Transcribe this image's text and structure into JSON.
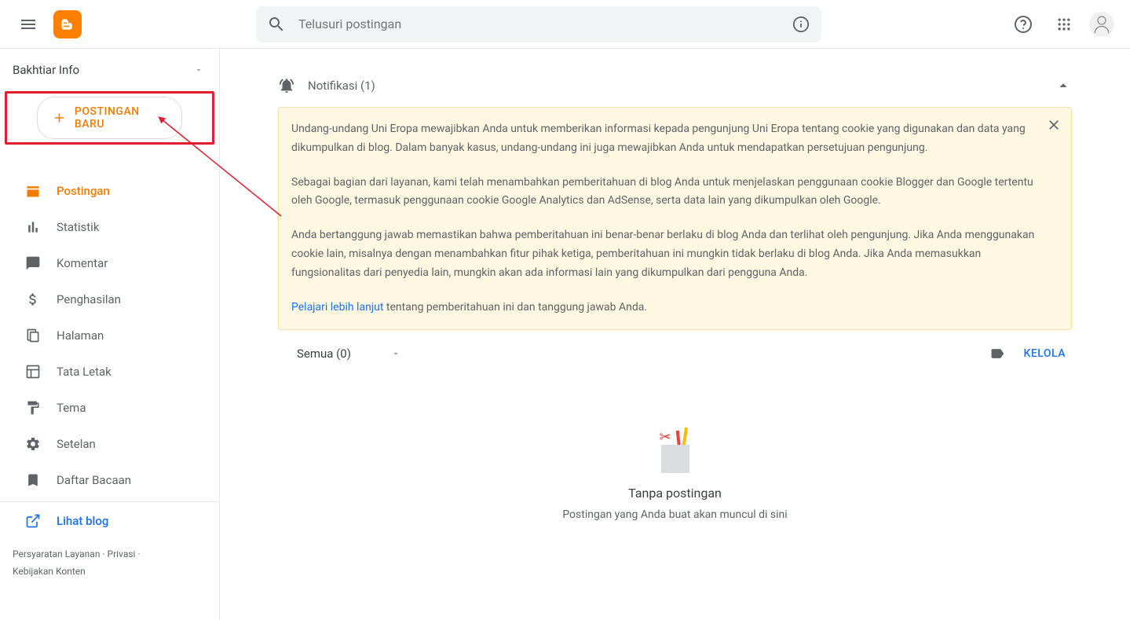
{
  "header": {
    "search_placeholder": "Telusuri postingan"
  },
  "sidebar": {
    "blog_name": "Bakhtiar Info",
    "new_post_label": "POSTINGAN BARU",
    "nav": {
      "postingan": "Postingan",
      "statistik": "Statistik",
      "komentar": "Komentar",
      "penghasilan": "Penghasilan",
      "halaman": "Halaman",
      "tata_letak": "Tata Letak",
      "tema": "Tema",
      "setelan": "Setelan",
      "daftar_bacaan": "Daftar Bacaan",
      "lihat_blog": "Lihat blog"
    },
    "footer": {
      "tos": "Persyaratan Layanan",
      "privacy": "Privasi",
      "content_policy": "Kebijakan Konten"
    }
  },
  "main": {
    "notification_title": "Notifikasi (1)",
    "warning": {
      "p1": "Undang-undang Uni Eropa mewajibkan Anda untuk memberikan informasi kepada pengunjung Uni Eropa tentang cookie yang digunakan dan data yang dikumpulkan di blog. Dalam banyak kasus, undang-undang ini juga mewajibkan Anda untuk mendapatkan persetujuan pengunjung.",
      "p2": "Sebagai bagian dari layanan, kami telah menambahkan pemberitahuan di blog Anda untuk menjelaskan penggunaan cookie Blogger dan Google tertentu oleh Google, termasuk penggunaan cookie Google Analytics dan AdSense, serta data lain yang dikumpulkan oleh Google.",
      "p3": "Anda bertanggung jawab memastikan bahwa pemberitahuan ini benar-benar berlaku di blog Anda dan terlihat oleh pengunjung. Jika Anda menggunakan cookie lain, misalnya dengan menambahkan fitur pihak ketiga, pemberitahuan ini mungkin tidak berlaku di blog Anda. Jika Anda memasukkan fungsionalitas dari penyedia lain, mungkin akan ada informasi lain yang dikumpulkan dari pengguna Anda.",
      "link_text": "Pelajari lebih lanjut",
      "link_after": " tentang pemberitahuan ini dan tanggung jawab Anda."
    },
    "filter": {
      "label": "Semua (0)",
      "kelola": "KELOLA"
    },
    "empty": {
      "title": "Tanpa postingan",
      "sub": "Postingan yang Anda buat akan muncul di sini"
    }
  }
}
